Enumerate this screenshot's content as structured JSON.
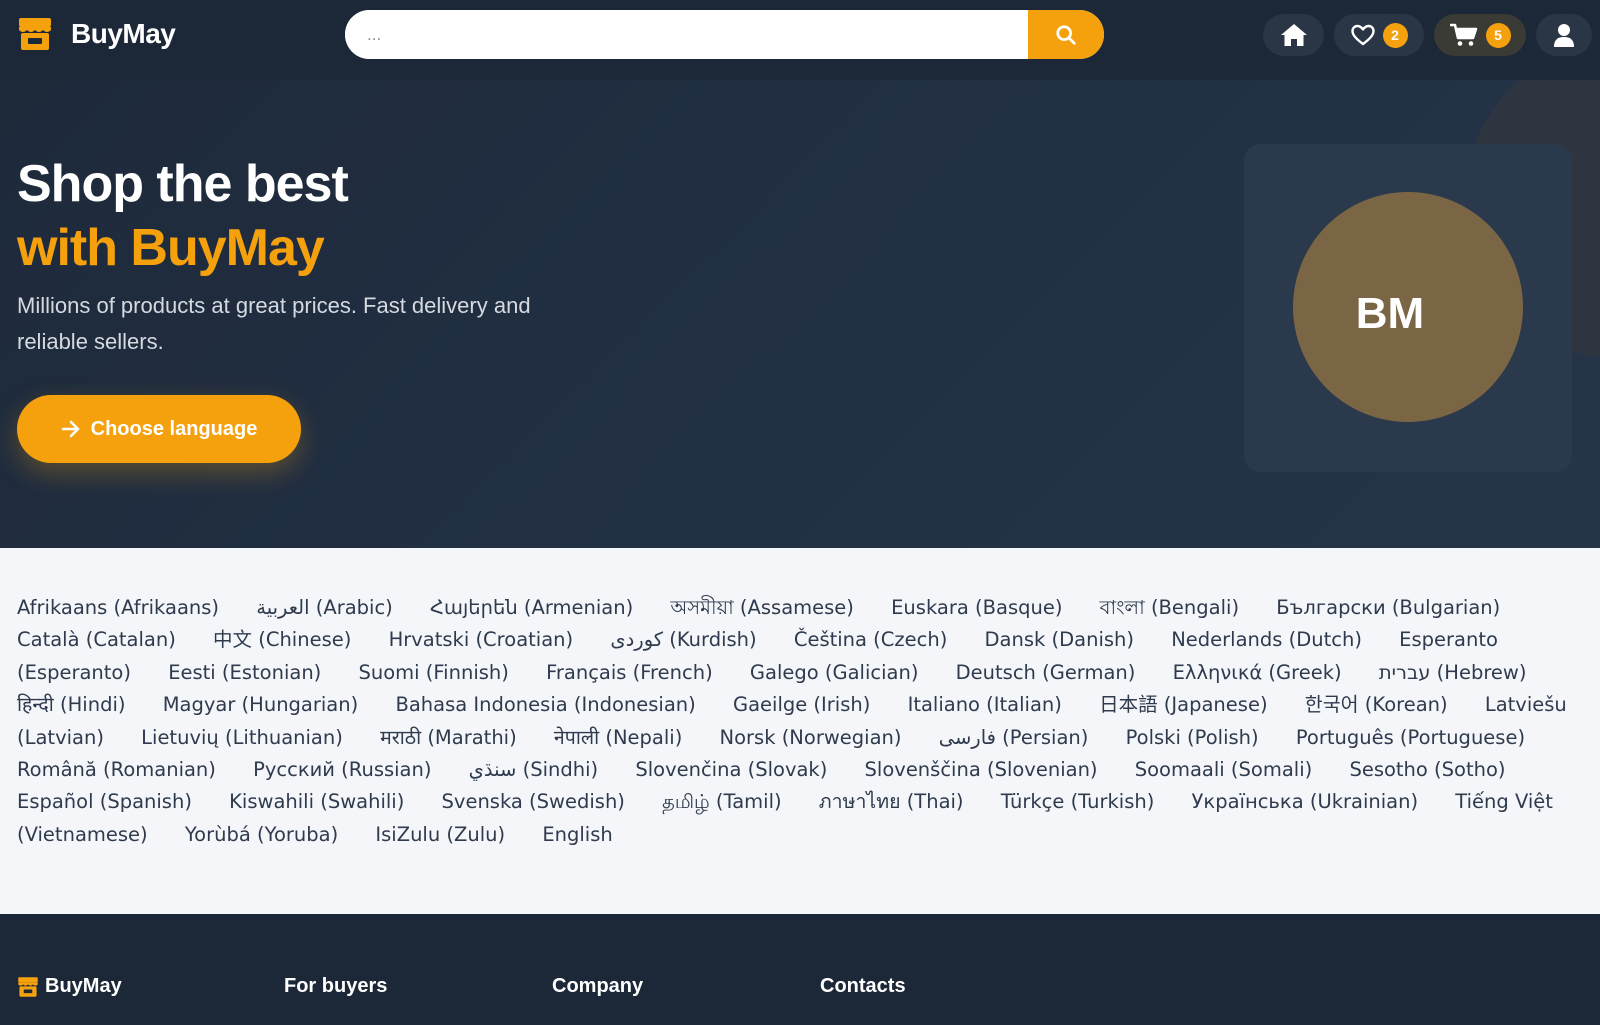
{
  "header": {
    "brand": "BuyMay",
    "search_placeholder": "...",
    "favorites_count": "2",
    "cart_count": "5",
    "icons": [
      "store-logo-icon",
      "search-icon",
      "home-icon",
      "heart-icon",
      "cart-icon",
      "user-icon"
    ]
  },
  "hero": {
    "title": "Shop the best",
    "title_accent": "with BuyMay",
    "subtitle": "Millions of products at great prices. Fast delivery and reliable sellers.",
    "cta_label": "Choose language",
    "logo_initials": "BM"
  },
  "languages": [
    "Afrikaans (Afrikaans)",
    "العربية (Arabic)",
    "Հայերեն (Armenian)",
    "অসমীয়া (Assamese)",
    "Euskara (Basque)",
    "বাংলা (Bengali)",
    "Български (Bulgarian)",
    "Català (Catalan)",
    "中文 (Chinese)",
    "Hrvatski (Croatian)",
    "کوردی (Kurdish)",
    "Čeština (Czech)",
    "Dansk (Danish)",
    "Nederlands (Dutch)",
    "Esperanto (Esperanto)",
    "Eesti (Estonian)",
    "Suomi (Finnish)",
    "Français (French)",
    "Galego (Galician)",
    "Deutsch (German)",
    "Ελληνικά (Greek)",
    "עברית (Hebrew)",
    "हिन्दी (Hindi)",
    "Magyar (Hungarian)",
    "Bahasa Indonesia (Indonesian)",
    "Gaeilge (Irish)",
    "Italiano (Italian)",
    "日本語 (Japanese)",
    "한국어 (Korean)",
    "Latviešu (Latvian)",
    "Lietuvių (Lithuanian)",
    "मराठी (Marathi)",
    "नेपाली (Nepali)",
    "Norsk (Norwegian)",
    "فارسی (Persian)",
    "Polski (Polish)",
    "Português (Portuguese)",
    "Română (Romanian)",
    "Русский (Russian)",
    "سنڌي (Sindhi)",
    "Slovenčina (Slovak)",
    "Slovenščina (Slovenian)",
    "Soomaali (Somali)",
    "Sesotho (Sotho)",
    "Español (Spanish)",
    "Kiswahili (Swahili)",
    "Svenska (Swedish)",
    "தமிழ் (Tamil)",
    "ภาษาไทย (Thai)",
    "Türkçe (Turkish)",
    "Українська (Ukrainian)",
    "Tiếng Việt (Vietnamese)",
    "Yorùbá (Yoruba)",
    "IsiZulu (Zulu)",
    "English"
  ],
  "footer": {
    "brand": "BuyMay",
    "col_buyers": "For buyers",
    "col_company": "Company",
    "col_contacts": "Contacts"
  },
  "colors": {
    "accent": "#f5a10e",
    "header_bg": "#1c2838",
    "hero_bg": "#223045",
    "languages_bg": "#f4f6fa",
    "logo_circle": "#7a6645"
  }
}
